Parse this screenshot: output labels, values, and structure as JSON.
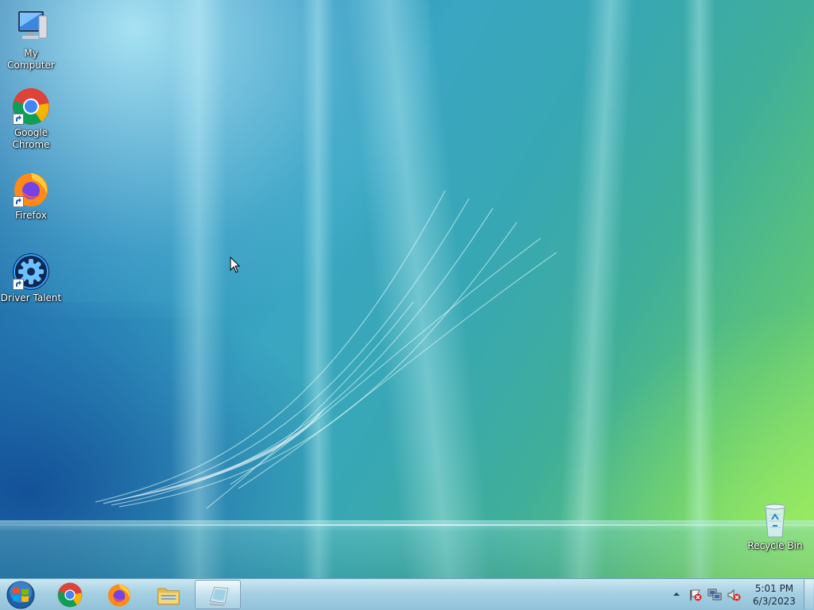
{
  "desktop": {
    "icons": [
      {
        "label": "My Computer",
        "icon": "computer-icon"
      },
      {
        "label": "Google Chrome",
        "icon": "chrome-icon"
      },
      {
        "label": "Firefox",
        "icon": "firefox-icon"
      },
      {
        "label": "Driver Talent",
        "icon": "driver-talent-icon"
      },
      {
        "label": "Recycle Bin",
        "icon": "recycle-bin-icon"
      }
    ]
  },
  "taskbar": {
    "start_icon": "windows-start-icon",
    "pinned": [
      {
        "name": "chrome",
        "icon": "chrome-icon",
        "active": false
      },
      {
        "name": "firefox",
        "icon": "firefox-icon",
        "active": false
      },
      {
        "name": "file-explorer",
        "icon": "folder-icon",
        "active": false
      },
      {
        "name": "window",
        "icon": "window-app-icon",
        "active": true
      }
    ],
    "tray": {
      "icons": [
        "show-hidden-icons-chevron-icon",
        "action-center-flag-icon",
        "network-icon",
        "volume-muted-icon"
      ],
      "time": "5:01 PM",
      "date": "6/3/2023"
    }
  },
  "colors": {
    "taskbar": "#a8cfe0",
    "label_text": "#ffffff"
  }
}
